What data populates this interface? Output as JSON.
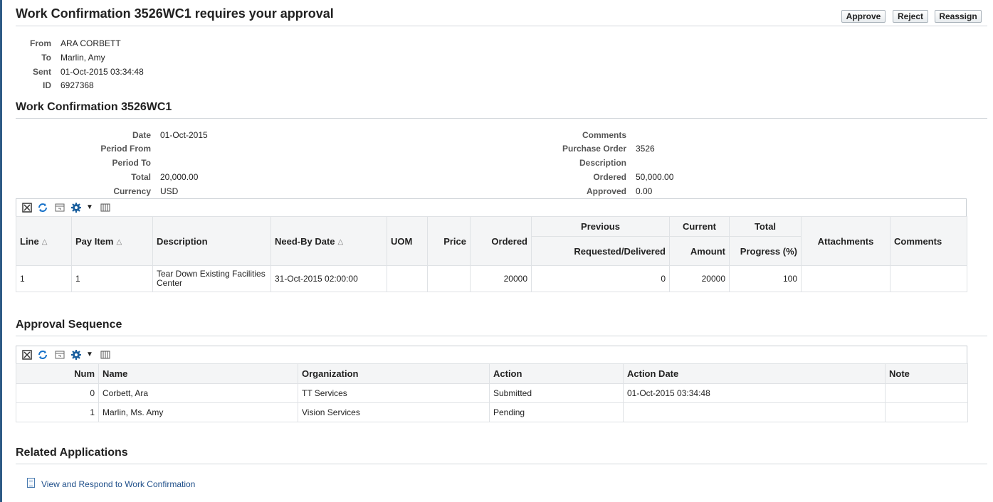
{
  "page": {
    "title": "Work Confirmation 3526WC1 requires your approval",
    "buttons": {
      "approve": "Approve",
      "reject": "Reject",
      "reassign": "Reassign"
    }
  },
  "notification": {
    "from_label": "From",
    "from": "ARA CORBETT",
    "to_label": "To",
    "to": "Marlin, Amy",
    "sent_label": "Sent",
    "sent": "01-Oct-2015 03:34:48",
    "id_label": "ID",
    "id": "6927368"
  },
  "work_confirmation": {
    "title": "Work Confirmation 3526WC1",
    "left_fields": [
      {
        "label": "Date",
        "value": "01-Oct-2015"
      },
      {
        "label": "Period From",
        "value": ""
      },
      {
        "label": "Period To",
        "value": ""
      },
      {
        "label": "Total",
        "value": "20,000.00"
      },
      {
        "label": "Currency",
        "value": "USD"
      }
    ],
    "right_fields": [
      {
        "label": "Comments",
        "value": ""
      },
      {
        "label": "Purchase Order",
        "value": "3526"
      },
      {
        "label": "Description",
        "value": ""
      },
      {
        "label": "Ordered",
        "value": "50,000.00"
      },
      {
        "label": "Approved",
        "value": "0.00"
      }
    ]
  },
  "lines_table": {
    "headers": {
      "line": "Line",
      "pay_item": "Pay Item",
      "description": "Description",
      "need_by_date": "Need-By Date",
      "uom": "UOM",
      "price": "Price",
      "ordered": "Ordered",
      "previous": "Previous",
      "requested_delivered": "Requested/Delivered",
      "current": "Current",
      "amount": "Amount",
      "total": "Total",
      "progress": "Progress (%)",
      "attachments": "Attachments",
      "comments": "Comments"
    },
    "rows": [
      {
        "line": "1",
        "pay_item": "1",
        "description": "Tear Down Existing Facilities Center",
        "need_by_date": "31-Oct-2015 02:00:00",
        "uom": "",
        "price": "",
        "ordered": "20000",
        "requested_delivered": "0",
        "amount": "20000",
        "progress": "100",
        "attachments": "",
        "comments": ""
      }
    ]
  },
  "approval_sequence": {
    "title": "Approval Sequence",
    "headers": {
      "num": "Num",
      "name": "Name",
      "organization": "Organization",
      "action": "Action",
      "action_date": "Action Date",
      "note": "Note"
    },
    "rows": [
      {
        "num": "0",
        "name": "Corbett, Ara",
        "organization": "TT Services",
        "action": "Submitted",
        "action_date": "01-Oct-2015 03:34:48",
        "note": ""
      },
      {
        "num": "1",
        "name": "Marlin, Ms. Amy",
        "organization": "Vision Services",
        "action": "Pending",
        "action_date": "",
        "note": ""
      }
    ]
  },
  "related": {
    "title": "Related Applications",
    "link": "View and Respond to Work Confirmation"
  },
  "icons": [
    "detach-icon",
    "refresh-icon",
    "query-by-example-icon",
    "gear-icon",
    "dropdown-arrow-icon",
    "columns-icon",
    "sort-ascending-icon",
    "document-icon"
  ],
  "colors": {
    "accent": "#2e5b86",
    "link": "#1f4f8a",
    "icon_blue": "#1a5f9e"
  }
}
